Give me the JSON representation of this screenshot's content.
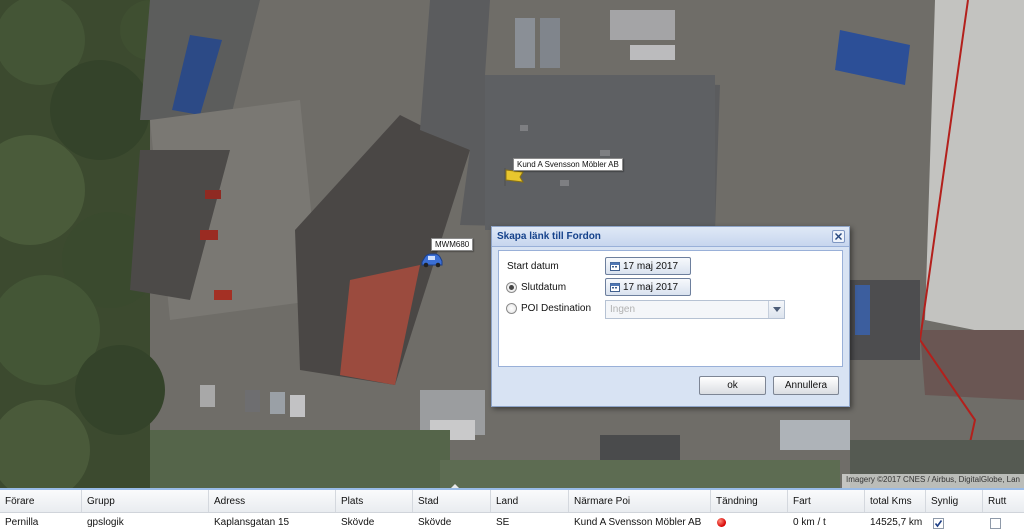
{
  "map": {
    "poi_label": "Kund A Svensson Möbler AB",
    "vehicle_label": "MWM680",
    "attribution": "Imagery ©2017 CNES / Airbus, DigitalGlobe, Lan",
    "icons": {
      "poi_flag": "flag-icon",
      "vehicle": "car-icon"
    }
  },
  "dialog": {
    "title": "Skapa länk till Fordon",
    "start_label": "Start datum",
    "start_date": "17 maj 2017",
    "end_label": "Slutdatum",
    "end_date": "17 maj 2017",
    "end_selected": true,
    "poi_label": "POI Destination",
    "poi_selected": false,
    "poi_value": "Ingen",
    "ok_label": "ok",
    "cancel_label": "Annullera"
  },
  "grid": {
    "columns": [
      "Förare",
      "Grupp",
      "Adress",
      "Plats",
      "Stad",
      "Land",
      "Närmare Poi",
      "Tändning",
      "Fart",
      "total Kms",
      "Synlig",
      "Rutt"
    ],
    "rows": [
      {
        "forare": "Pernilla",
        "grupp": "gpslogik",
        "adress": "Kaplansgatan 15",
        "plats": "Skövde",
        "stad": "Skövde",
        "land": "SE",
        "narmare_poi": "Kund A Svensson Möbler AB",
        "tandning": "on",
        "fart": "0 km / t",
        "total_kms": "14525,7 km",
        "synlig": true,
        "rutt": false
      }
    ]
  },
  "colors": {
    "dialog_title": "#15428b",
    "ignition_on": "#d60000",
    "grid_border": "#99bbe8"
  }
}
